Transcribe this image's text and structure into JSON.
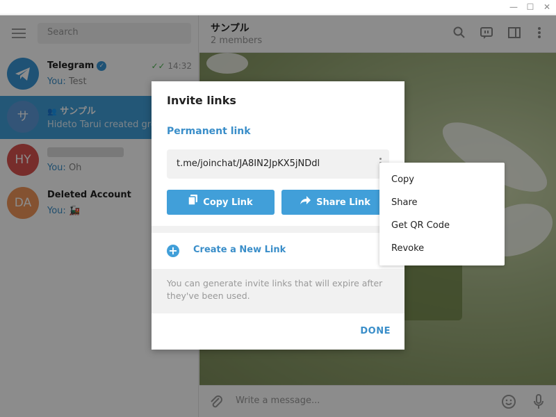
{
  "window": {
    "minimize": "—",
    "maximize": "☐",
    "close": "✕"
  },
  "sidebar": {
    "search_placeholder": "Search",
    "chats": [
      {
        "title": "Telegram",
        "you": "You:",
        "message": "Test",
        "time": "14:32",
        "avatar_initials": "",
        "avatar_color": "#3a95d5"
      },
      {
        "title": "サンプル",
        "message": "Hideto Tarui created grou",
        "avatar_initials": "サ",
        "avatar_color": "#5d9ad9"
      },
      {
        "title": "",
        "you": "You:",
        "message": "Oh",
        "avatar_initials": "HY",
        "avatar_color": "#d9534f"
      },
      {
        "title": "Deleted Account",
        "you": "You:",
        "message": "🚂",
        "avatar_initials": "DA",
        "avatar_color": "#f0965a"
      }
    ]
  },
  "chat": {
    "title": "サンプル",
    "subtitle": "2 members",
    "input_placeholder": "Write a message..."
  },
  "modal": {
    "title": "Invite links",
    "permanent_label": "Permanent link",
    "link": "t.me/joinchat/JA8IN2JpKX5jNDdl",
    "copy_label": "Copy Link",
    "share_label": "Share Link",
    "create_label": "Create a New Link",
    "info": "You can generate invite links that will expire after they've been used.",
    "done_label": "DONE"
  },
  "context_menu": {
    "items": [
      "Copy",
      "Share",
      "Get QR Code",
      "Revoke"
    ]
  },
  "colors": {
    "accent": "#419fd9",
    "link": "#3a8ec9"
  }
}
